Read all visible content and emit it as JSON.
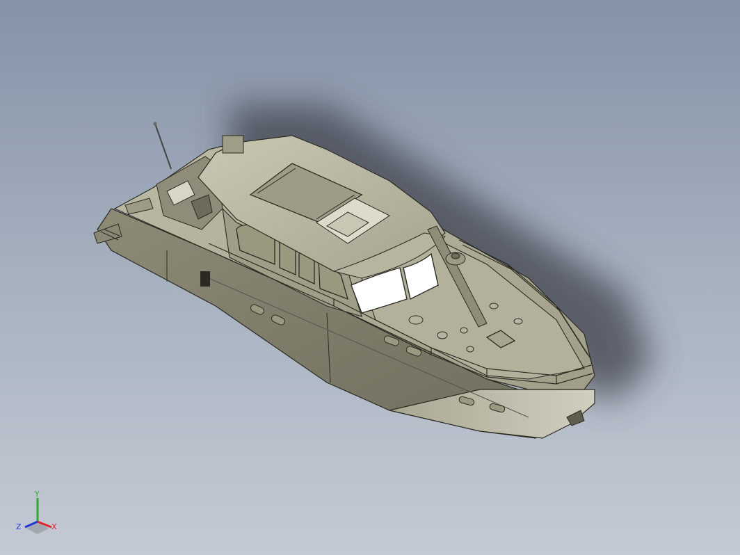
{
  "viewport": {
    "background_top": "#8593a8",
    "background_bottom": "#c4cad4",
    "model_color": "#a7a58f",
    "model_shadow": "#4b4f57"
  },
  "triad": {
    "x_label": "X",
    "y_label": "Y",
    "z_label": "Z",
    "x_color": "#e0242a",
    "y_color": "#2fa82f",
    "z_color": "#2236d6"
  }
}
